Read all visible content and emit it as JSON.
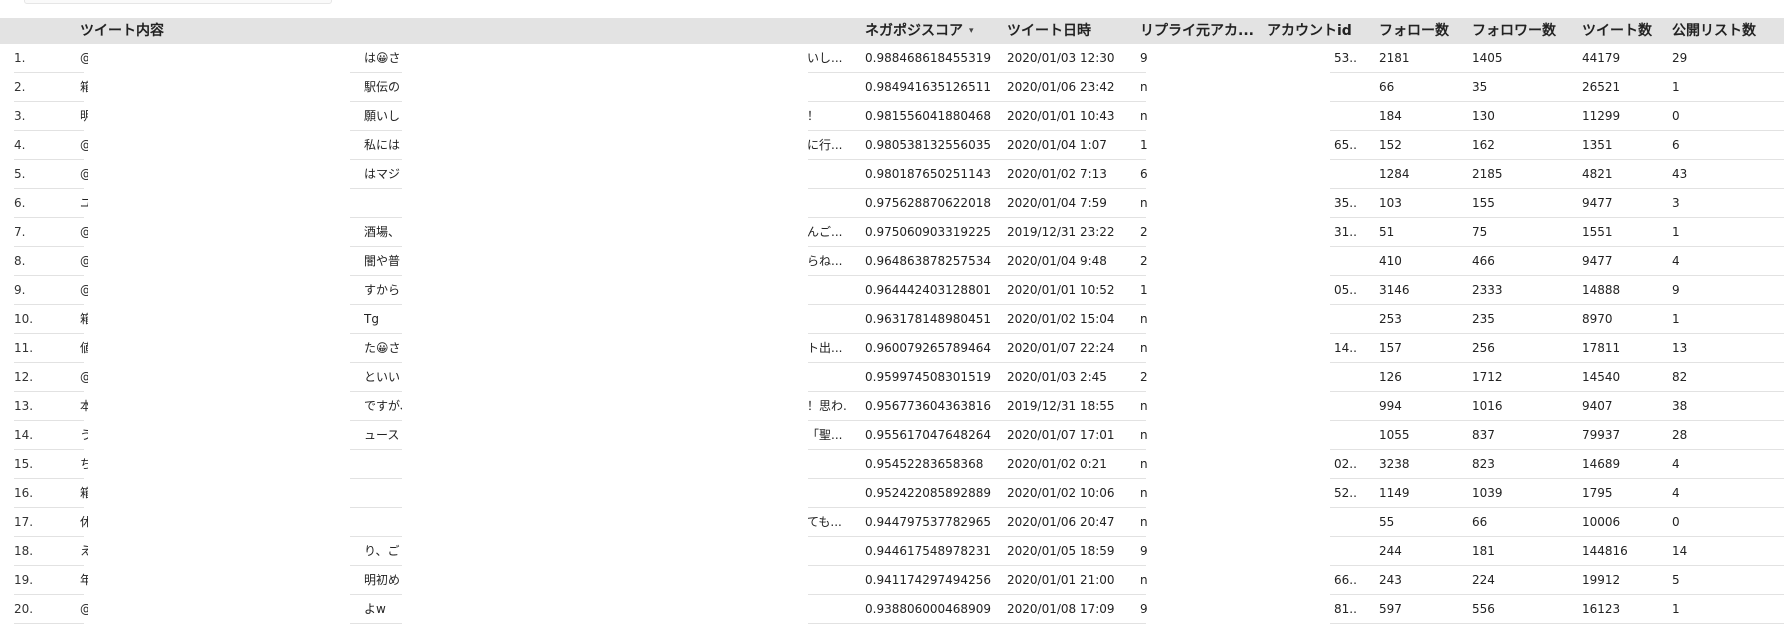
{
  "headers": {
    "tweet": "ツイート内容",
    "score": "ネガポジスコア",
    "date": "ツイート日時",
    "reply": "リプライ元アカ...",
    "account": "アカウントid",
    "follow": "フォロー数",
    "follower": "フォロワー数",
    "tweets": "ツイート数",
    "lists": "公開リスト数"
  },
  "sort_icon": "▾",
  "rows": [
    {
      "num": "1.",
      "t1": "@",
      "t2": "は😀さ",
      "t3": "いし...",
      "score": "0.988468618455319",
      "date": "2020/01/03 12:30",
      "reply": "9",
      "acc": "53...",
      "follow": "2181",
      "follower": "1405",
      "tweets": "44179",
      "lists": "29"
    },
    {
      "num": "2.",
      "t1": "箱",
      "t2": "駅伝の",
      "t3": "",
      "score": "0.984941635126511",
      "date": "2020/01/06 23:42",
      "reply": "n",
      "acc": "",
      "follow": "66",
      "follower": "35",
      "tweets": "26521",
      "lists": "1"
    },
    {
      "num": "3.",
      "t1": "明",
      "t2": "願いし",
      "t3": "！",
      "score": "0.981556041880468",
      "date": "2020/01/01 10:43",
      "reply": "n",
      "acc": "",
      "follow": "184",
      "follower": "130",
      "tweets": "11299",
      "lists": "0"
    },
    {
      "num": "4.",
      "t1": "@",
      "t2": "私には",
      "t3": "に行...",
      "score": "0.980538132556035",
      "date": "2020/01/04 1:07",
      "reply": "1",
      "acc": "65...",
      "follow": "152",
      "follower": "162",
      "tweets": "1351",
      "lists": "6"
    },
    {
      "num": "5.",
      "t1": "@",
      "t2": "はマジ",
      "t3": "",
      "score": "0.980187650251143",
      "date": "2020/01/02 7:13",
      "reply": "6",
      "acc": "",
      "follow": "1284",
      "follower": "2185",
      "tweets": "4821",
      "lists": "43"
    },
    {
      "num": "6.",
      "t1": "ユ",
      "t2": "",
      "t3": "",
      "score": "0.975628870622018",
      "date": "2020/01/04 7:59",
      "reply": "n",
      "acc": "35...",
      "follow": "103",
      "follower": "155",
      "tweets": "9477",
      "lists": "3"
    },
    {
      "num": "7.",
      "t1": "@",
      "t2": "酒場、",
      "t3": "んご...",
      "score": "0.975060903319225",
      "date": "2019/12/31 23:22",
      "reply": "2",
      "acc": "31...",
      "follow": "51",
      "follower": "75",
      "tweets": "1551",
      "lists": "1"
    },
    {
      "num": "8.",
      "t1": "@",
      "t2": "闇や普",
      "t3": "らね...",
      "score": "0.964863878257534",
      "date": "2020/01/04 9:48",
      "reply": "2",
      "acc": "",
      "follow": "410",
      "follower": "466",
      "tweets": "9477",
      "lists": "4"
    },
    {
      "num": "9.",
      "t1": "@",
      "t2": "すから",
      "t3": "",
      "score": "0.964442403128801",
      "date": "2020/01/01 10:52",
      "reply": "1",
      "acc": "05...",
      "follow": "3146",
      "follower": "2333",
      "tweets": "14888",
      "lists": "9"
    },
    {
      "num": "10.",
      "t1": "箱",
      "t2": "Tg",
      "t3": "",
      "score": "0.963178148980451",
      "date": "2020/01/02 15:04",
      "reply": "n",
      "acc": "",
      "follow": "253",
      "follower": "235",
      "tweets": "8970",
      "lists": "1"
    },
    {
      "num": "11.",
      "t1": "値",
      "t2": "た😀さ",
      "t3": "ト出...",
      "score": "0.960079265789464",
      "date": "2020/01/07 22:24",
      "reply": "n",
      "acc": "14...",
      "follow": "157",
      "follower": "256",
      "tweets": "17811",
      "lists": "13"
    },
    {
      "num": "12.",
      "t1": "@",
      "t2": "といい",
      "t3": "",
      "score": "0.959974508301519",
      "date": "2020/01/03 2:45",
      "reply": "2",
      "acc": "",
      "follow": "126",
      "follower": "1712",
      "tweets": "14540",
      "lists": "82"
    },
    {
      "num": "13.",
      "t1": "本",
      "t2": "ですが、",
      "t3": "！思わ...",
      "score": "0.956773604363816",
      "date": "2019/12/31 18:55",
      "reply": "n",
      "acc": "",
      "follow": "994",
      "follower": "1016",
      "tweets": "9407",
      "lists": "38"
    },
    {
      "num": "14.",
      "t1": "う",
      "t2": "ュース",
      "t3": "「聖...",
      "score": "0.955617047648264",
      "date": "2020/01/07 17:01",
      "reply": "n",
      "acc": "",
      "follow": "1055",
      "follower": "837",
      "tweets": "79937",
      "lists": "28"
    },
    {
      "num": "15.",
      "t1": "ち",
      "t2": "",
      "t3": "",
      "score": "0.95452283658368",
      "date": "2020/01/02 0:21",
      "reply": "n",
      "acc": "02...",
      "follow": "3238",
      "follower": "823",
      "tweets": "14689",
      "lists": "4"
    },
    {
      "num": "16.",
      "t1": "箱",
      "t2": "",
      "t3": "",
      "score": "0.952422085892889",
      "date": "2020/01/02 10:06",
      "reply": "n",
      "acc": "52...",
      "follow": "1149",
      "follower": "1039",
      "tweets": "1795",
      "lists": "4"
    },
    {
      "num": "17.",
      "t1": "休",
      "t2": "",
      "t3": "ても...",
      "score": "0.944797537782965",
      "date": "2020/01/06 20:47",
      "reply": "n",
      "acc": "",
      "follow": "55",
      "follower": "66",
      "tweets": "10006",
      "lists": "0"
    },
    {
      "num": "18.",
      "t1": "え",
      "t2": "り、ご",
      "t3": "",
      "score": "0.944617548978231",
      "date": "2020/01/05 18:59",
      "reply": "9",
      "acc": "",
      "follow": "244",
      "follower": "181",
      "tweets": "144816",
      "lists": "14"
    },
    {
      "num": "19.",
      "t1": "年",
      "t2": "明初め",
      "t3": "",
      "score": "0.941174297494256",
      "date": "2020/01/01 21:00",
      "reply": "n",
      "acc": "66...",
      "follow": "243",
      "follower": "224",
      "tweets": "19912",
      "lists": "5"
    },
    {
      "num": "20.",
      "t1": "@",
      "t2": "よw",
      "t3": "",
      "score": "0.938806000468909",
      "date": "2020/01/08 17:09",
      "reply": "9",
      "acc": "81...",
      "follow": "597",
      "follower": "556",
      "tweets": "16123",
      "lists": "1"
    }
  ]
}
